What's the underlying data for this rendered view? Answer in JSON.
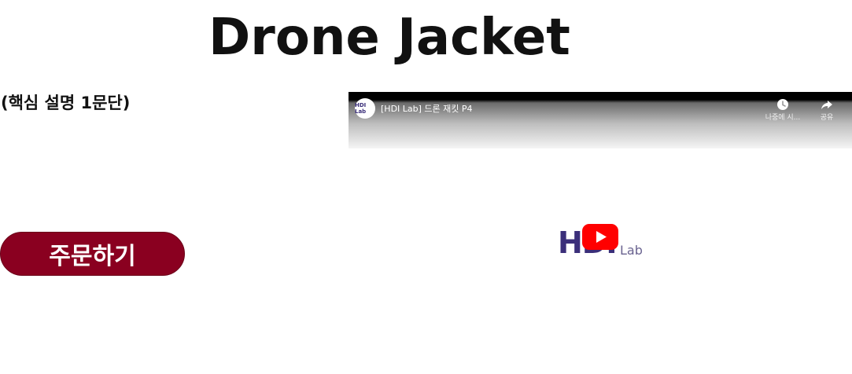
{
  "product": {
    "title": "Drone Jacket",
    "description": "(핵심 설명 1문단)",
    "order_button": "주문하기"
  },
  "video": {
    "title": "[HDI Lab] 드론 재킷 P4",
    "channel_logo_text": "HDI Lab",
    "actions": {
      "watch_later": "나중에 시...",
      "share": "공유"
    },
    "logo": {
      "main": "HDI",
      "sub": "Lab"
    },
    "colors": {
      "play_button": "#ff0000",
      "logo": "#3b2f7a"
    },
    "icons": [
      "clock-icon",
      "share-arrow-icon",
      "youtube-play-icon"
    ]
  },
  "colors": {
    "order_button_bg": "#8a0020",
    "text": "#111111"
  }
}
